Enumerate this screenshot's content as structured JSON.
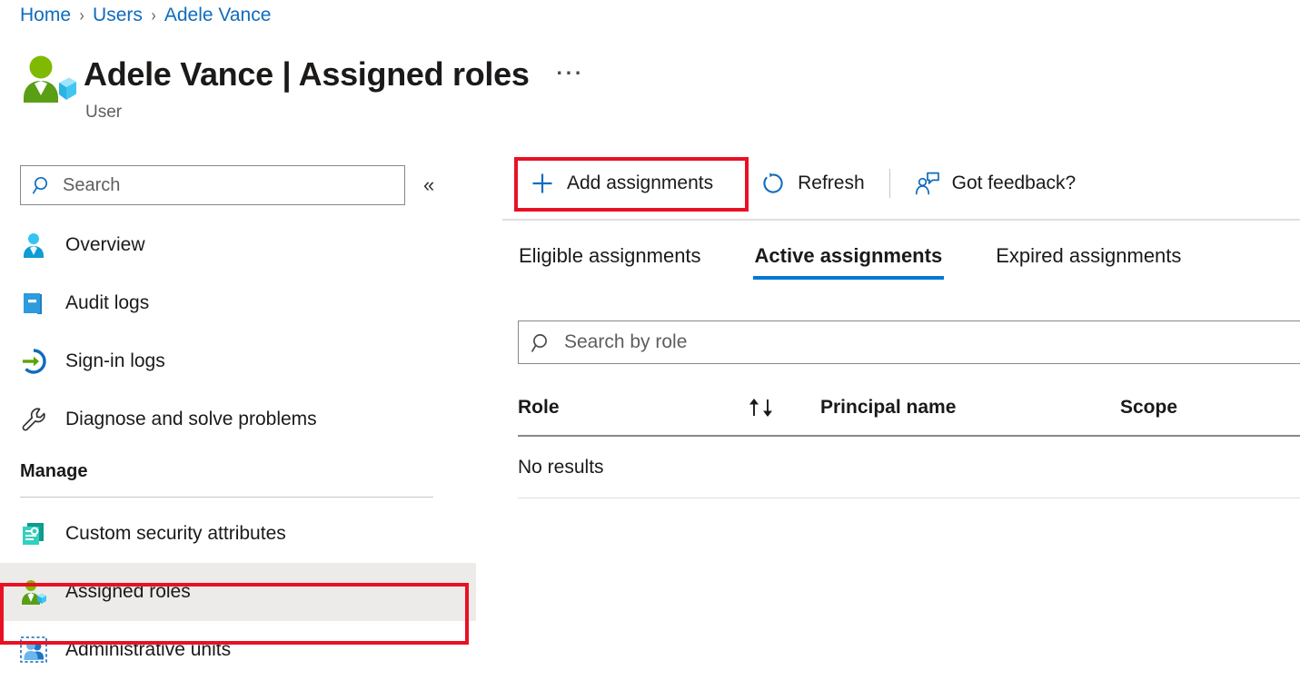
{
  "breadcrumb": {
    "items": [
      {
        "label": "Home"
      },
      {
        "label": "Users"
      },
      {
        "label": "Adele Vance"
      }
    ],
    "separator": "›"
  },
  "header": {
    "title": "Adele Vance | Assigned roles",
    "subtitle": "User",
    "more_label": "···",
    "icon": "user-with-cube-icon"
  },
  "sidebar": {
    "search": {
      "placeholder": "Search",
      "value": "",
      "icon": "search-icon"
    },
    "collapse": {
      "label": "«",
      "icon": "chevron-double-left-icon"
    },
    "items": [
      {
        "label": "Overview",
        "icon": "user-blue-icon",
        "selected": false
      },
      {
        "label": "Audit logs",
        "icon": "book-icon",
        "selected": false
      },
      {
        "label": "Sign-in logs",
        "icon": "sign-in-arrow-icon",
        "selected": false
      },
      {
        "label": "Diagnose and solve problems",
        "icon": "wrench-icon",
        "selected": false
      }
    ],
    "manage": {
      "label": "Manage",
      "items": [
        {
          "label": "Custom security attributes",
          "icon": "security-attributes-icon",
          "selected": false
        },
        {
          "label": "Assigned roles",
          "icon": "user-roles-green-icon",
          "selected": true
        },
        {
          "label": "Administrative units",
          "icon": "administrative-units-icon",
          "selected": false
        }
      ]
    }
  },
  "toolbar": {
    "add_assignments": {
      "label": "Add assignments",
      "icon": "plus-icon"
    },
    "refresh": {
      "label": "Refresh",
      "icon": "refresh-icon"
    },
    "feedback": {
      "label": "Got feedback?",
      "icon": "person-feedback-icon"
    }
  },
  "tabs": [
    {
      "label": "Eligible assignments",
      "active": false
    },
    {
      "label": "Active assignments",
      "active": true
    },
    {
      "label": "Expired assignments",
      "active": false
    }
  ],
  "content": {
    "search": {
      "placeholder": "Search by role",
      "value": "",
      "icon": "search-icon"
    },
    "table": {
      "columns": [
        {
          "label": "Role",
          "sortable": true,
          "sort_icon": "sort-updown-icon"
        },
        {
          "label": "Principal name",
          "sortable": false
        },
        {
          "label": "Scope",
          "sortable": false
        }
      ],
      "rows": [],
      "empty_message": "No results"
    }
  },
  "colors": {
    "accent": "#0078d4",
    "link": "#0f6cbd",
    "highlight_box": "#e81123",
    "selected_bg": "#edebe9",
    "text": "#1b1a19",
    "muted_text": "#605e5c"
  }
}
